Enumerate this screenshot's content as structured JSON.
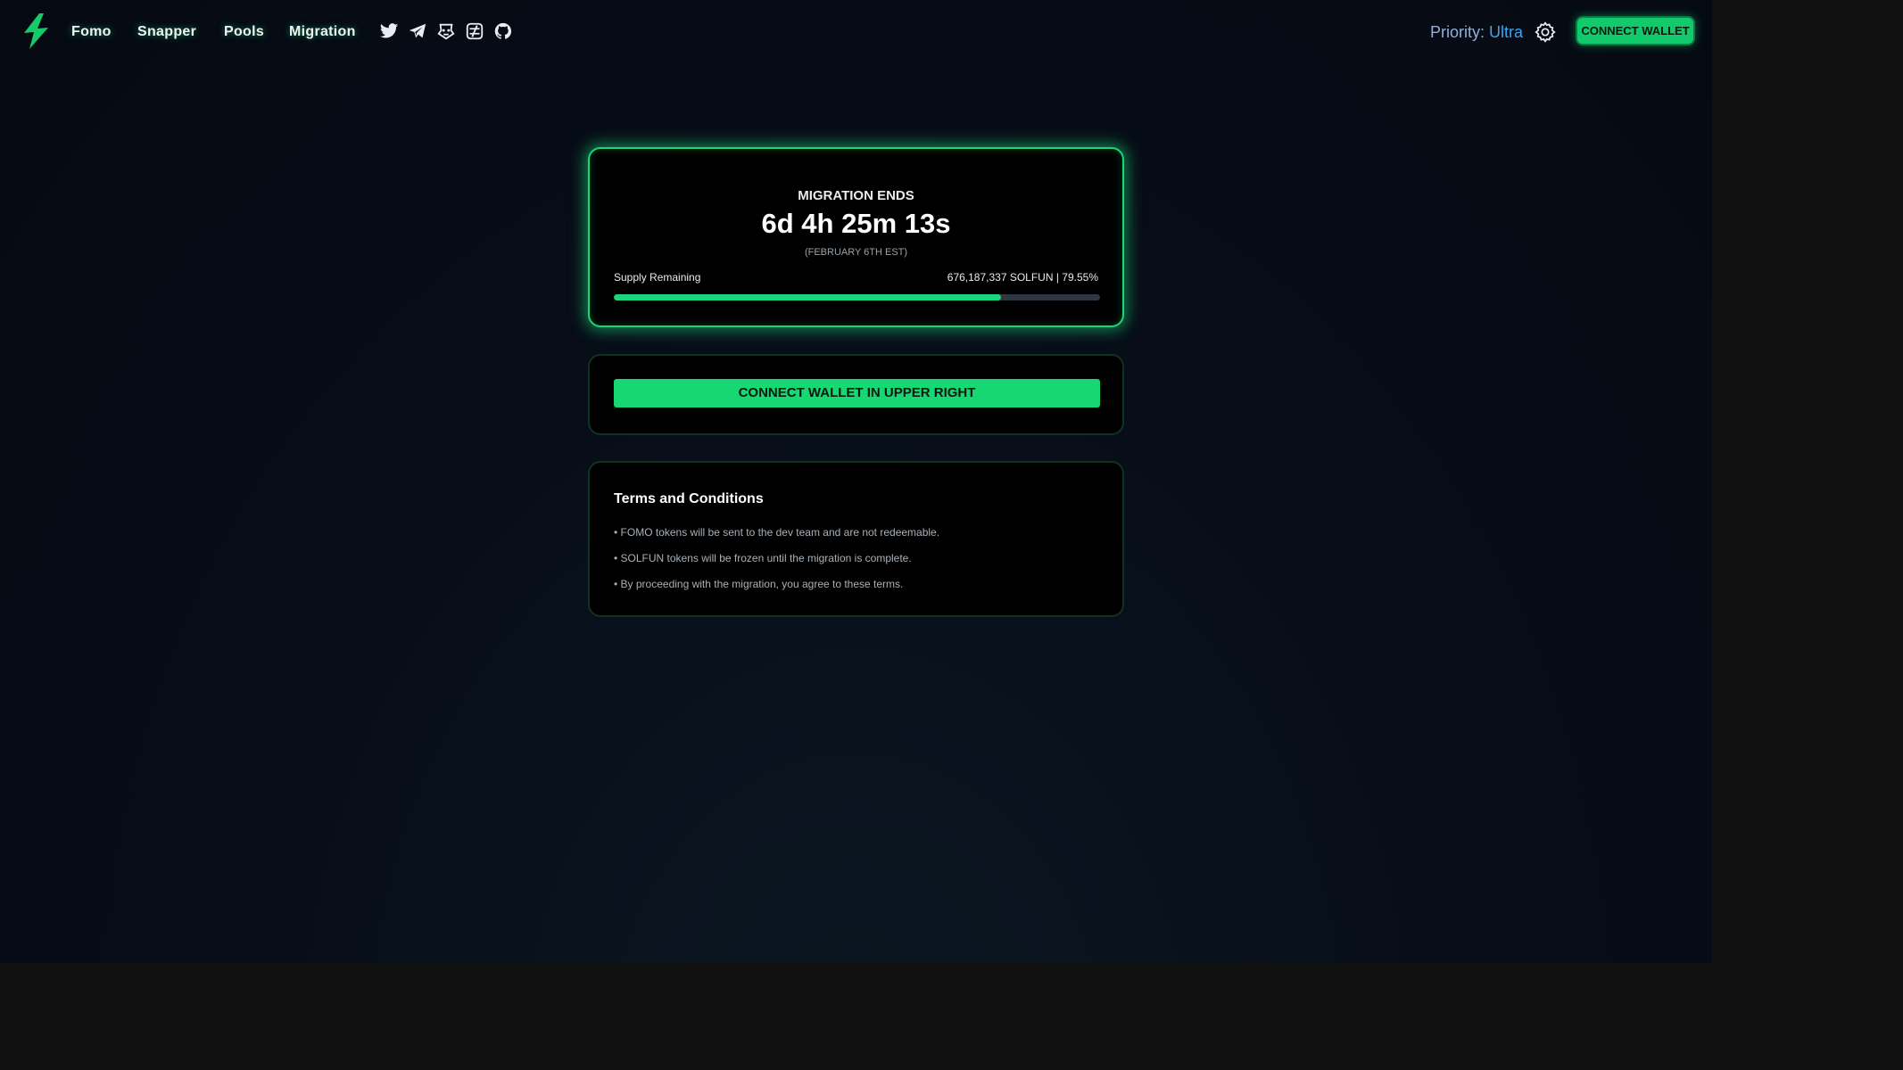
{
  "nav": {
    "links": [
      "Fomo",
      "Snapper",
      "Pools",
      "Migration"
    ],
    "social_icons": [
      "twitter-icon",
      "telegram-icon",
      "robot-icon",
      "exchange-icon",
      "github-icon"
    ],
    "priority_label": "Priority:",
    "priority_value": "Ultra",
    "connect_button": "CONNECT WALLET"
  },
  "migration": {
    "title": "MIGRATION ENDS",
    "countdown": "6d 4h 25m 13s",
    "date_note": "(FEBRUARY 6TH EST)",
    "supply_label": "Supply Remaining",
    "supply_value": "676,187,337 SOLFUN | 79.55%",
    "supply_percent": 79.55
  },
  "action": {
    "button": "CONNECT WALLET IN UPPER RIGHT"
  },
  "terms": {
    "title": "Terms and Conditions",
    "items": [
      "• FOMO tokens will be sent to the dev team and are not redeemable.",
      "• SOLFUN tokens will be frozen until the migration is complete.",
      "• By proceeding with the migration, you agree to these terms."
    ]
  },
  "colors": {
    "accent": "#1bd57a",
    "priority": "#3aa6f0",
    "background": "#070d17"
  }
}
